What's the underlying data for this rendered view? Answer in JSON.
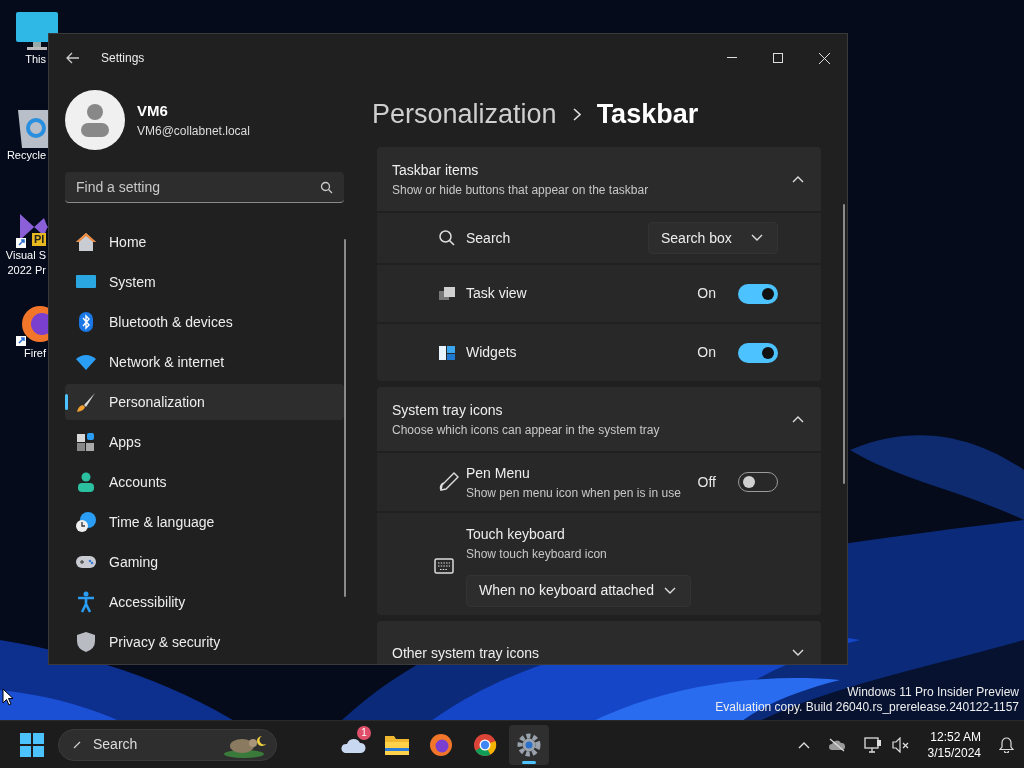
{
  "desktop_icons": [
    {
      "lines": [
        "This"
      ]
    },
    {
      "lines": [
        "Recycle"
      ]
    },
    {
      "lines": [
        "Visual S",
        "2022 Pr"
      ],
      "badge": "PI"
    },
    {
      "lines": [
        "Firef"
      ]
    }
  ],
  "window": {
    "title": "Settings",
    "user": {
      "name": "VM6",
      "email": "VM6@collabnet.local"
    },
    "search": {
      "placeholder": "Find a setting"
    },
    "nav": [
      {
        "label": "Home",
        "selected": false
      },
      {
        "label": "System",
        "selected": false
      },
      {
        "label": "Bluetooth & devices",
        "selected": false
      },
      {
        "label": "Network & internet",
        "selected": false
      },
      {
        "label": "Personalization",
        "selected": true
      },
      {
        "label": "Apps",
        "selected": false
      },
      {
        "label": "Accounts",
        "selected": false
      },
      {
        "label": "Time & language",
        "selected": false
      },
      {
        "label": "Gaming",
        "selected": false
      },
      {
        "label": "Accessibility",
        "selected": false
      },
      {
        "label": "Privacy & security",
        "selected": false
      }
    ],
    "breadcrumb": {
      "parent": "Personalization",
      "current": "Taskbar"
    },
    "sections": [
      {
        "title": "Taskbar items",
        "subtitle": "Show or hide buttons that appear on the taskbar",
        "expanded": true,
        "rows": [
          {
            "kind": "dropdown",
            "label": "Search",
            "value": "Search box"
          },
          {
            "kind": "toggle",
            "label": "Task view",
            "on": true,
            "state_text": "On"
          },
          {
            "kind": "toggle",
            "label": "Widgets",
            "on": true,
            "state_text": "On"
          }
        ]
      },
      {
        "title": "System tray icons",
        "subtitle": "Choose which icons can appear in the system tray",
        "expanded": true,
        "rows": [
          {
            "kind": "toggle",
            "label": "Pen Menu",
            "description": "Show pen menu icon when pen is in use",
            "on": false,
            "state_text": "Off"
          },
          {
            "kind": "dropdown_below",
            "label": "Touch keyboard",
            "description": "Show touch keyboard icon",
            "value": "When no keyboard attached"
          }
        ]
      },
      {
        "title": "Other system tray icons",
        "expanded": false
      }
    ]
  },
  "watermark": [
    "Windows 11 Pro Insider Preview",
    "Evaluation copy. Build 26040.rs_prerelease.240122-1157"
  ],
  "taskbar": {
    "search": {
      "placeholder": "Search"
    },
    "apps": [
      {
        "selected": false,
        "badge": "1"
      },
      {
        "selected": false
      },
      {
        "selected": false
      },
      {
        "selected": false
      },
      {
        "selected": true
      }
    ],
    "clock": {
      "time": "12:52 AM",
      "date": "3/15/2024"
    }
  }
}
